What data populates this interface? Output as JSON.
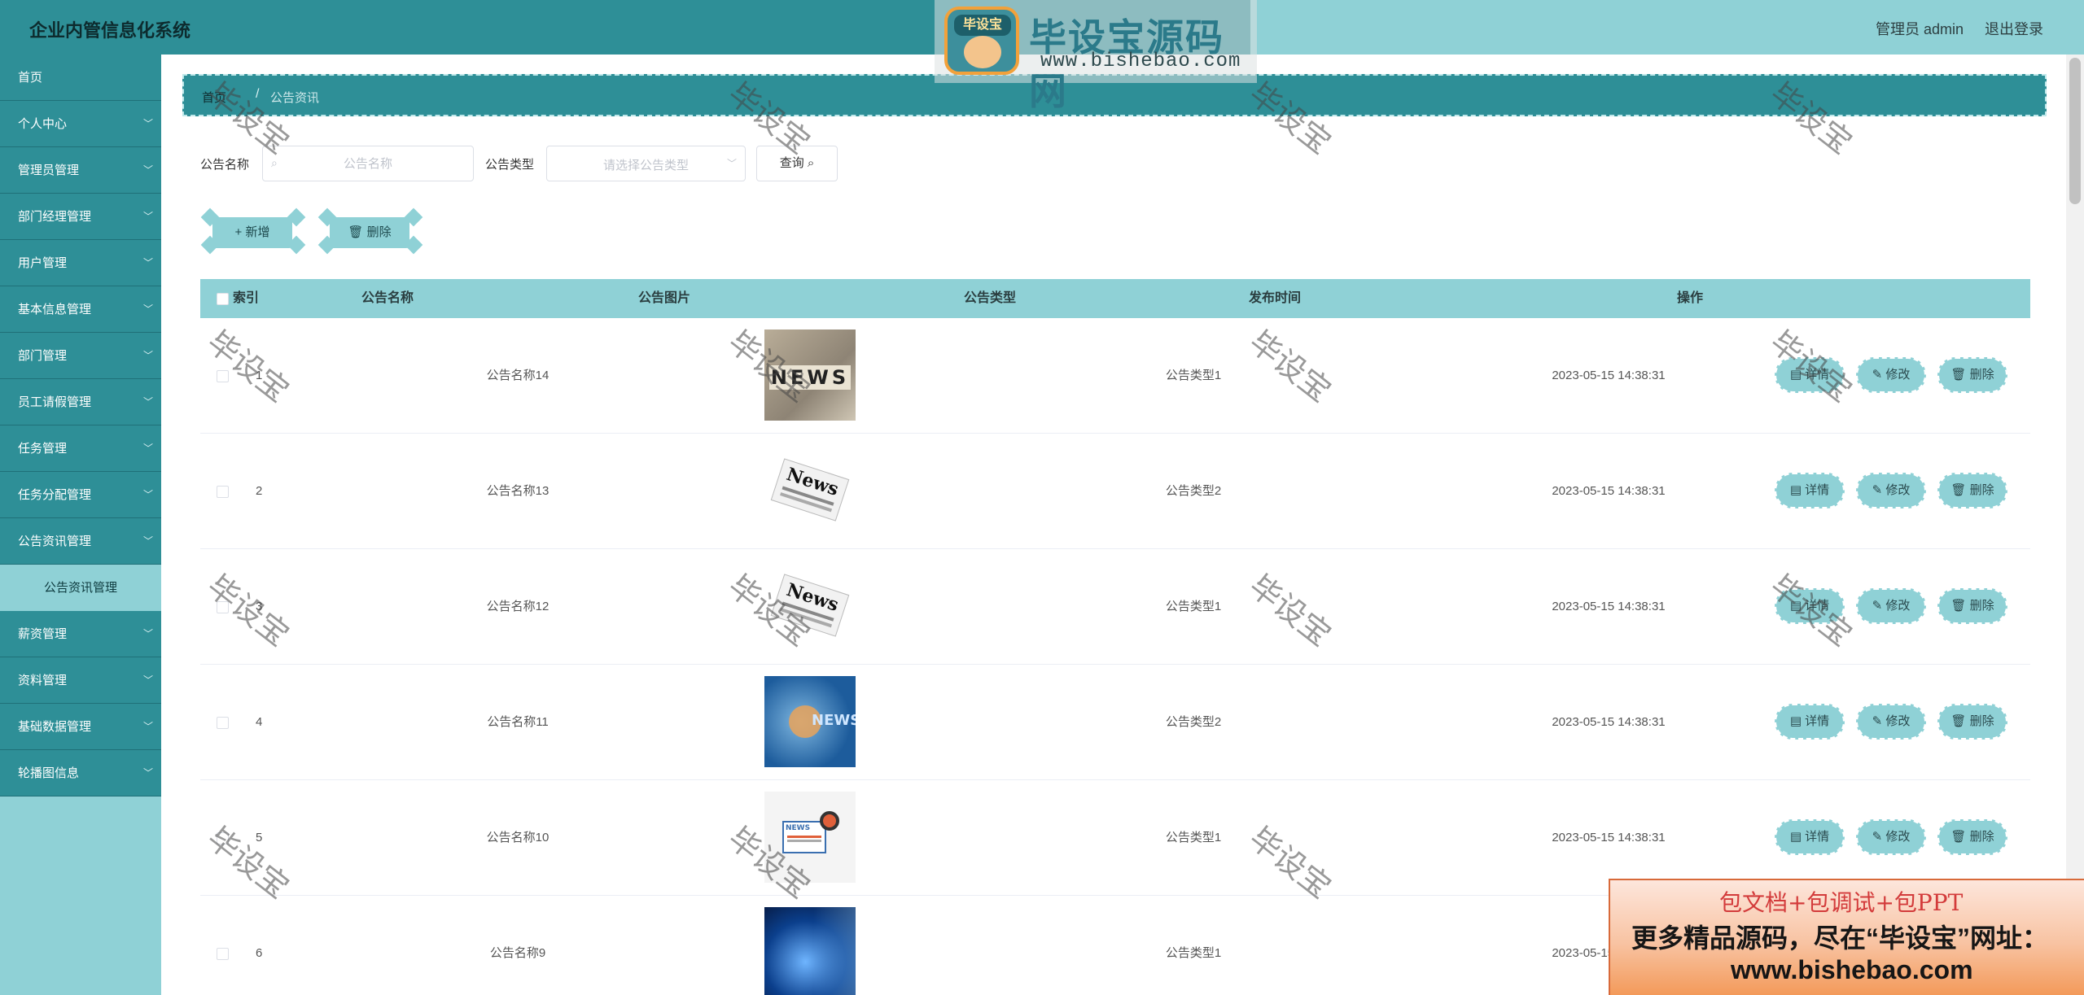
{
  "app": {
    "title": "企业内管信息化系统",
    "user_label": "管理员 admin",
    "logout_label": "退出登录"
  },
  "watermark_logo": {
    "badge_text": "毕设宝",
    "name": "毕设宝源码网",
    "url": "www.bishebao.com"
  },
  "sidebar": {
    "items": [
      {
        "label": "首页",
        "has_chevron": false
      },
      {
        "label": "个人中心",
        "has_chevron": true
      },
      {
        "label": "管理员管理",
        "has_chevron": true
      },
      {
        "label": "部门经理管理",
        "has_chevron": true
      },
      {
        "label": "用户管理",
        "has_chevron": true
      },
      {
        "label": "基本信息管理",
        "has_chevron": true
      },
      {
        "label": "部门管理",
        "has_chevron": true
      },
      {
        "label": "员工请假管理",
        "has_chevron": true
      },
      {
        "label": "任务管理",
        "has_chevron": true
      },
      {
        "label": "任务分配管理",
        "has_chevron": true
      },
      {
        "label": "公告资讯管理",
        "has_chevron": true,
        "expanded": true
      },
      {
        "label": "薪资管理",
        "has_chevron": true
      },
      {
        "label": "资料管理",
        "has_chevron": true
      },
      {
        "label": "基础数据管理",
        "has_chevron": true
      },
      {
        "label": "轮播图信息",
        "has_chevron": true
      }
    ],
    "active_sub": "公告资讯管理"
  },
  "breadcrumb": {
    "home": "首页",
    "separator": "/",
    "current": "公告资讯"
  },
  "search": {
    "name_label": "公告名称",
    "name_placeholder": "公告名称",
    "type_label": "公告类型",
    "type_placeholder": "请选择公告类型",
    "query_button": "查询"
  },
  "actions": {
    "add_button": "+ 新增",
    "delete_button": "删除"
  },
  "table": {
    "columns": [
      "索引",
      "公告名称",
      "公告图片",
      "公告类型",
      "发布时间",
      "操作"
    ],
    "rows": [
      {
        "index": "1",
        "name": "公告名称14",
        "image": "news-print",
        "type": "公告类型1",
        "time": "2023-05-15 14:38:31"
      },
      {
        "index": "2",
        "name": "公告名称13",
        "image": "newspaper",
        "type": "公告类型2",
        "time": "2023-05-15 14:38:31"
      },
      {
        "index": "3",
        "name": "公告名称12",
        "image": "newspaper",
        "type": "公告类型1",
        "time": "2023-05-15 14:38:31"
      },
      {
        "index": "4",
        "name": "公告名称11",
        "image": "news-blue",
        "type": "公告类型2",
        "time": "2023-05-15 14:38:31"
      },
      {
        "index": "5",
        "name": "公告名称10",
        "image": "news-laptop",
        "type": "公告类型1",
        "time": "2023-05-15 14:38:31"
      },
      {
        "index": "6",
        "name": "公告名称9",
        "image": "globe",
        "type": "公告类型1",
        "time": "2023-05-15 14:38:31"
      }
    ],
    "op_buttons": [
      "详情",
      "修改",
      "删除"
    ]
  },
  "watermark_text": "毕设宝",
  "banner": {
    "line1": "包文档+包调试+包PPT",
    "line2": "更多精品源码，尽在“毕设宝”网址：",
    "line3": "www.bishebao.com"
  },
  "colors": {
    "primary": "#2e8f97",
    "light": "#8fd1d6"
  }
}
